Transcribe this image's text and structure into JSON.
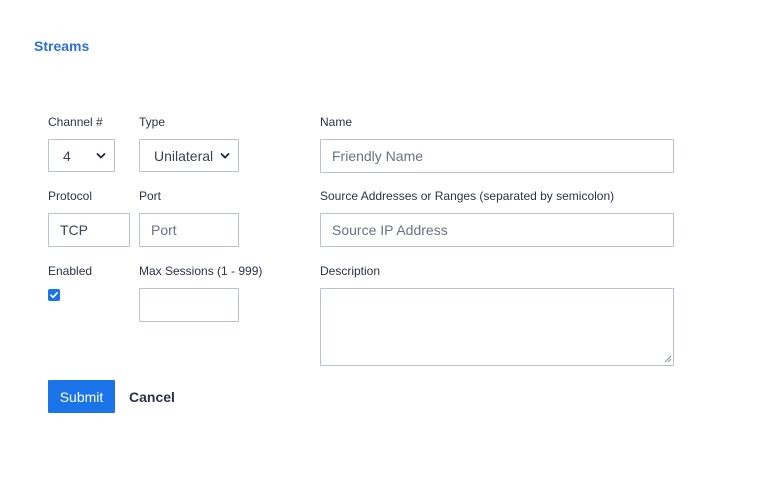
{
  "page": {
    "section_title": "Streams"
  },
  "form": {
    "channel": {
      "label": "Channel #",
      "value": "4"
    },
    "type": {
      "label": "Type",
      "value": "Unilateral"
    },
    "name": {
      "label": "Name",
      "value": "",
      "placeholder": "Friendly Name"
    },
    "protocol": {
      "label": "Protocol",
      "value": "TCP"
    },
    "port": {
      "label": "Port",
      "value": "",
      "placeholder": "Port"
    },
    "source_addresses": {
      "label": "Source Addresses or Ranges (separated by semicolon)",
      "value": "",
      "placeholder": "Source IP Address"
    },
    "enabled": {
      "label": "Enabled",
      "checked": true
    },
    "max_sessions": {
      "label": "Max Sessions (1 - 999)",
      "value": ""
    },
    "description": {
      "label": "Description",
      "value": ""
    }
  },
  "actions": {
    "submit_label": "Submit",
    "cancel_label": "Cancel"
  },
  "colors": {
    "accent": "#1a73e8",
    "title": "#2e6fd6",
    "border": "#b9c2d0"
  },
  "icons": {
    "select_arrow": "chevron-down-icon",
    "checkbox": "checkmark-icon",
    "resize": "resize-grip-icon"
  }
}
